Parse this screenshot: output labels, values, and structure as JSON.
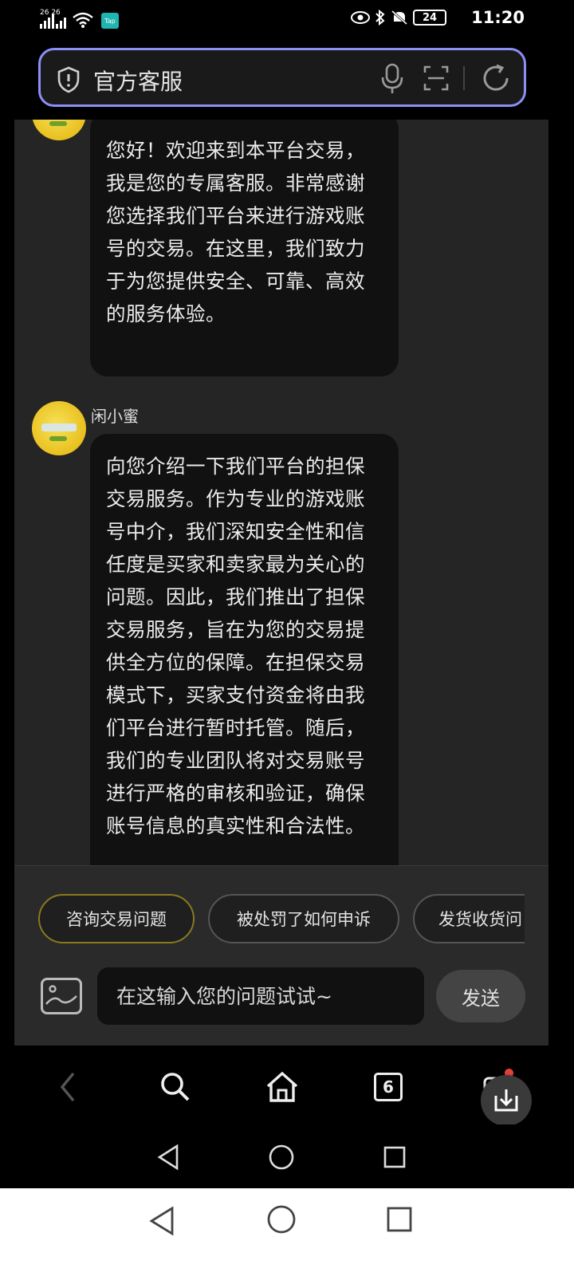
{
  "status_bar": {
    "signal_text": "26 26",
    "app_badge": "Tap",
    "battery": "24",
    "time": "11:20"
  },
  "url_bar": {
    "title": "官方客服",
    "icons": [
      "shield-icon",
      "mic-icon",
      "scan-icon",
      "reload-icon"
    ]
  },
  "chat": {
    "messages": [
      {
        "sender": "",
        "text": "您好！欢迎来到本平台交易，我是您的专属客服。非常感谢您选择我们平台来进行游戏账号的交易。在这里，我们致力于为您提供安全、可靠、高效的服务体验。"
      },
      {
        "sender": "闲小蜜",
        "text": "向您介绍一下我们平台的担保交易服务。作为专业的游戏账号中介，我们深知安全性和信任度是买家和卖家最为关心的问题。因此，我们推出了担保交易服务，旨在为您的交易提供全方位的保障。在担保交易模式下，买家支付资金将由我们平台进行暂时托管。随后，我们的专业团队将对交易账号进行严格的审核和验证，确保账号信息的真实性和合法性。"
      }
    ]
  },
  "quick_chips": [
    "咨询交易问题",
    "被处罚了如何申诉",
    "发货收货问"
  ],
  "composer": {
    "placeholder": "在这输入您的问题试试~",
    "send_label": "发送"
  },
  "browser_toolbar": {
    "tab_count": "6"
  },
  "colors": {
    "url_border": "#8c8ff5",
    "bubble_bg": "#111111",
    "chat_bg": "#252525",
    "active_chip_border": "#8a7a1e"
  }
}
